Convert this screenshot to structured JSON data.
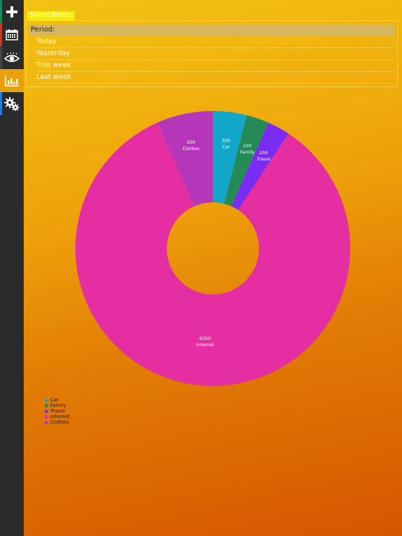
{
  "sidebar": {
    "items": [
      {
        "icon": "plus-icon",
        "stripe": "#1e8a5a"
      },
      {
        "icon": "calendar-icon",
        "stripe": "#c0392b"
      },
      {
        "icon": "eye-icon",
        "stripe": "#444444"
      },
      {
        "icon": "bar-chart-icon",
        "stripe": "#e8a10a"
      },
      {
        "icon": "gears-icon",
        "stripe": "#2d7dd2"
      }
    ],
    "active_index": 3
  },
  "filters": {
    "label": "Select filters:",
    "period_label": "Period:",
    "period_options": [
      "Today",
      "Yesterday",
      "This week",
      "Last week"
    ]
  },
  "chart_data": {
    "type": "pie",
    "variant": "donut",
    "title": "",
    "categories": [
      "Car",
      "Family",
      "Travel",
      "Internet",
      "Clothes"
    ],
    "values": [
      300,
      200,
      200,
      6350,
      500
    ],
    "colors": [
      "#12a7c8",
      "#238a58",
      "#7b2cf3",
      "#e62ea3",
      "#b636b9"
    ],
    "legend_position": "bottom-left"
  }
}
